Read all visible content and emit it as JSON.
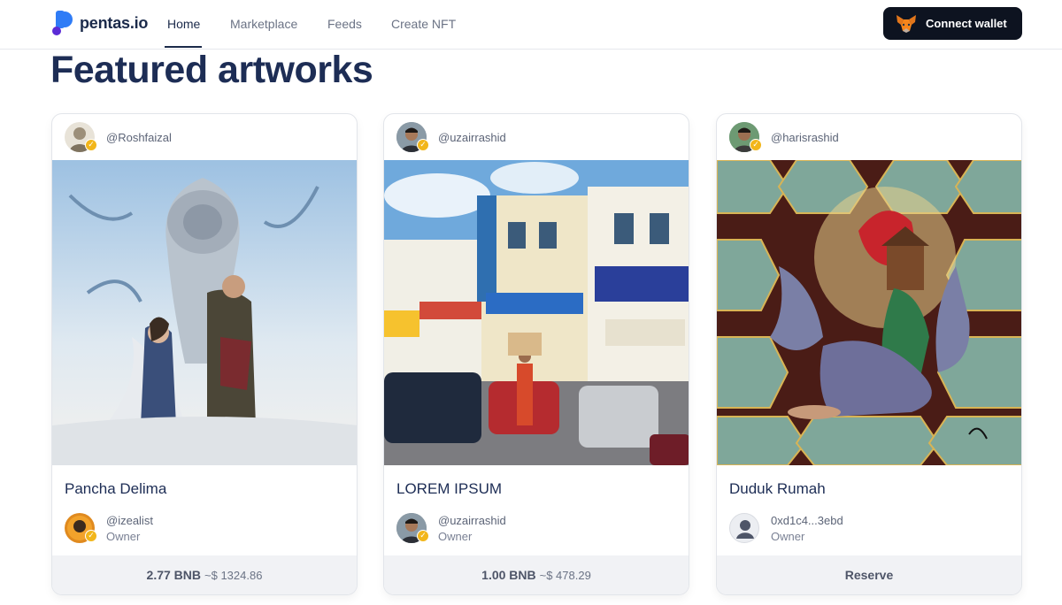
{
  "brand": {
    "name": "pentas.io"
  },
  "nav": {
    "links": [
      "Home",
      "Marketplace",
      "Feeds",
      "Create NFT"
    ],
    "active": "Home",
    "connect_label": "Connect wallet"
  },
  "page_title": "Featured artworks",
  "cards": [
    {
      "creator": "@Roshfaizal",
      "title": "Pancha Delima",
      "owner_name": "@izealist",
      "owner_label": "Owner",
      "price": "2.77 BNB",
      "usd": "~$ 1324.86"
    },
    {
      "creator": "@uzairrashid",
      "title": "LOREM IPSUM",
      "owner_name": "@uzairrashid",
      "owner_label": "Owner",
      "price": "1.00 BNB",
      "usd": "~$ 478.29"
    },
    {
      "creator": "@harisrashid",
      "title": "Duduk Rumah",
      "owner_name": "0xd1c4...3ebd",
      "owner_label": "Owner",
      "action": "Reserve"
    }
  ],
  "colors": {
    "brand_blue": "#1d2d55",
    "accent_gold": "#f2b61b",
    "wallet_btn": "#0d1320"
  }
}
